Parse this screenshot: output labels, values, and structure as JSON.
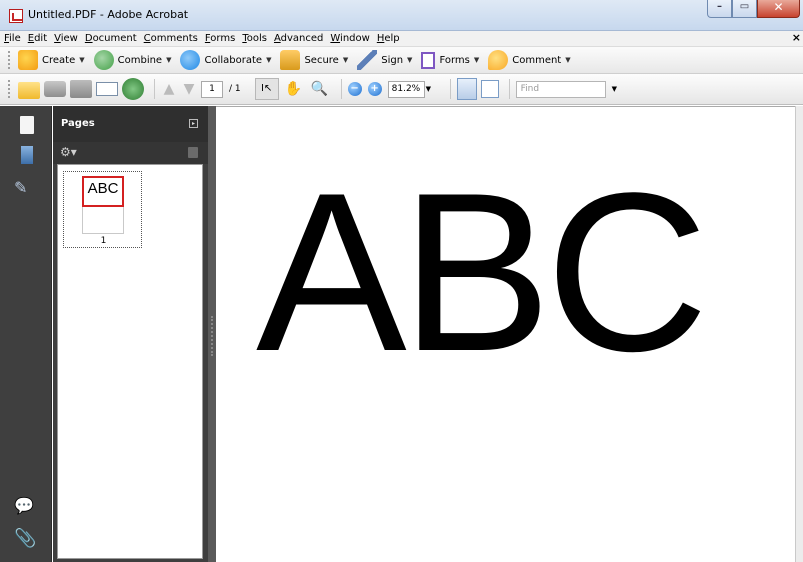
{
  "window": {
    "title": "Untitled.PDF - Adobe Acrobat",
    "minimize_icon": "minimize-icon",
    "maximize_icon": "maximize-icon",
    "close_glyph": "✕"
  },
  "menu": {
    "items": [
      "File",
      "Edit",
      "View",
      "Document",
      "Comments",
      "Forms",
      "Tools",
      "Advanced",
      "Window",
      "Help"
    ],
    "close_doc_glyph": "×"
  },
  "tasks": {
    "create": "Create",
    "combine": "Combine",
    "collaborate": "Collaborate",
    "secure": "Secure",
    "sign": "Sign",
    "forms": "Forms",
    "comment": "Comment"
  },
  "navbar": {
    "page_current": "1",
    "page_total": "/ 1",
    "zoom": "81.2%",
    "find_placeholder": "Find"
  },
  "pages_panel": {
    "title": "Pages",
    "thumbnail_text": "ABC",
    "thumbnail_label": "1"
  },
  "document": {
    "text": "ABC"
  },
  "colors": {
    "panel_dark": "#3f3f3f",
    "thumbnail_highlight": "#d42020"
  }
}
